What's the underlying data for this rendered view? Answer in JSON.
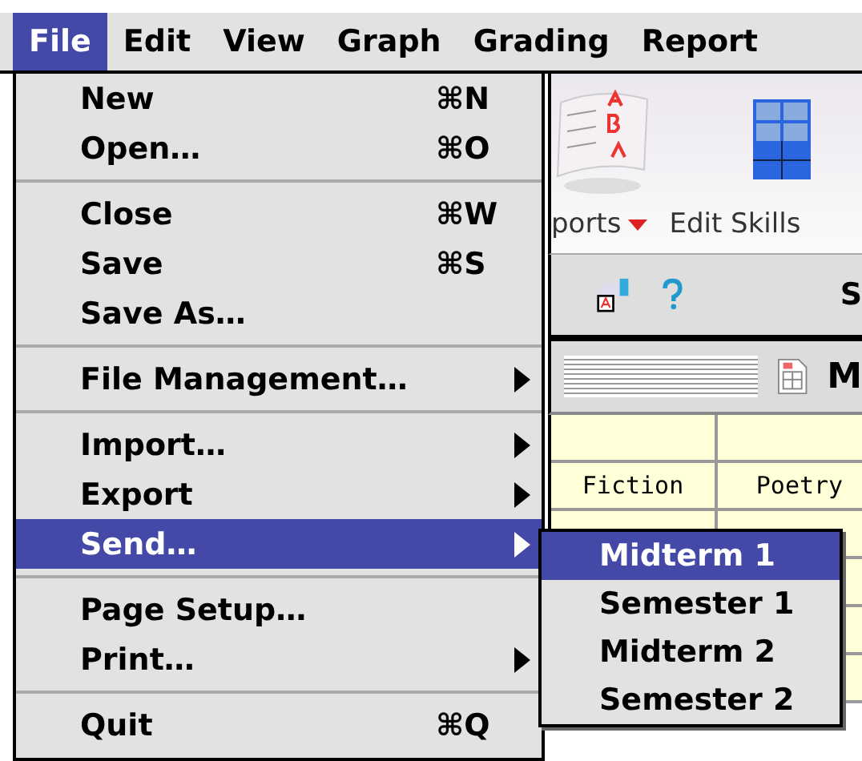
{
  "menubar": [
    {
      "label": "File",
      "selected": true
    },
    {
      "label": "Edit",
      "selected": false
    },
    {
      "label": "View",
      "selected": false
    },
    {
      "label": "Graph",
      "selected": false
    },
    {
      "label": "Grading",
      "selected": false
    },
    {
      "label": "Report",
      "selected": false
    }
  ],
  "file_menu": [
    {
      "kind": "item",
      "label": "New",
      "shortcut": "⌘N",
      "submenu": false,
      "selected": false
    },
    {
      "kind": "item",
      "label": "Open…",
      "shortcut": "⌘O",
      "submenu": false,
      "selected": false
    },
    {
      "kind": "separator"
    },
    {
      "kind": "item",
      "label": "Close",
      "shortcut": "⌘W",
      "submenu": false,
      "selected": false
    },
    {
      "kind": "item",
      "label": "Save",
      "shortcut": "⌘S",
      "submenu": false,
      "selected": false
    },
    {
      "kind": "item",
      "label": "Save As…",
      "submenu": false,
      "selected": false
    },
    {
      "kind": "separator"
    },
    {
      "kind": "item",
      "label": "File Management…",
      "submenu": true,
      "selected": false
    },
    {
      "kind": "separator"
    },
    {
      "kind": "item",
      "label": "Import…",
      "submenu": true,
      "selected": false
    },
    {
      "kind": "item",
      "label": "Export",
      "submenu": true,
      "selected": false
    },
    {
      "kind": "item",
      "label": "Send…",
      "submenu": true,
      "selected": true
    },
    {
      "kind": "separator"
    },
    {
      "kind": "item",
      "label": "Page Setup…",
      "submenu": false,
      "selected": false
    },
    {
      "kind": "item",
      "label": "Print…",
      "submenu": true,
      "selected": false
    },
    {
      "kind": "separator"
    },
    {
      "kind": "item",
      "label": "Quit",
      "shortcut": "⌘Q",
      "submenu": false,
      "selected": false
    }
  ],
  "send_submenu": [
    {
      "label": "Midterm 1",
      "selected": true
    },
    {
      "label": "Semester 1",
      "selected": false
    },
    {
      "label": "Midterm 2",
      "selected": false
    },
    {
      "label": "Semester 2",
      "selected": false
    }
  ],
  "toolbar": [
    {
      "label": "ports",
      "dropdown": true
    },
    {
      "label": "Edit Skills",
      "dropdown": false
    }
  ],
  "toolbar_2": {
    "title": "S"
  },
  "sheet_bar": {
    "title": "M"
  },
  "table": {
    "columns": [
      "Fiction",
      "Poetry"
    ]
  }
}
